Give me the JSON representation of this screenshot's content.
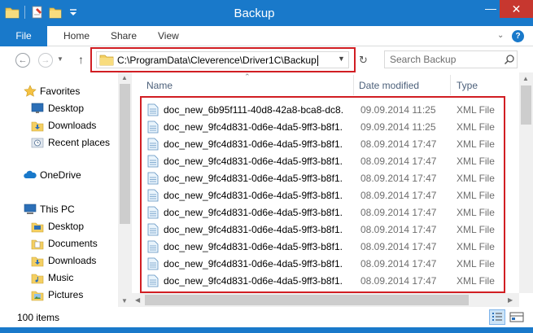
{
  "window": {
    "title": "Backup",
    "minimize_glyph": "—",
    "close_glyph": "✕"
  },
  "ribbon": {
    "file_tab": "File",
    "tabs": [
      "Home",
      "Share",
      "View"
    ],
    "expand_glyph": "⌄",
    "help_glyph": "?"
  },
  "address": {
    "path": "C:\\ProgramData\\Cleverence\\Driver1C\\Backup",
    "search_placeholder": "Search Backup"
  },
  "nav_pane": {
    "items": [
      {
        "label": "Favorites",
        "icon": "star-icon"
      },
      {
        "label": "Desktop",
        "icon": "desktop-icon"
      },
      {
        "label": "Downloads",
        "icon": "downloads-icon"
      },
      {
        "label": "Recent places",
        "icon": "recent-places-icon"
      },
      {
        "label": "OneDrive",
        "icon": "onedrive-icon"
      },
      {
        "label": "This PC",
        "icon": "computer-icon"
      },
      {
        "label": "Desktop",
        "icon": "desktop-icon"
      },
      {
        "label": "Documents",
        "icon": "documents-icon"
      },
      {
        "label": "Downloads",
        "icon": "downloads-icon"
      },
      {
        "label": "Music",
        "icon": "music-icon"
      },
      {
        "label": "Pictures",
        "icon": "pictures-icon"
      }
    ]
  },
  "file_list": {
    "columns": {
      "name": "Name",
      "date": "Date modified",
      "type": "Type"
    },
    "rows": [
      {
        "name": "doc_new_6b95f111-40d8-42a8-bca8-dc8...",
        "date": "09.09.2014 11:25",
        "type": "XML File"
      },
      {
        "name": "doc_new_9fc4d831-0d6e-4da5-9ff3-b8f1...",
        "date": "09.09.2014 11:25",
        "type": "XML File"
      },
      {
        "name": "doc_new_9fc4d831-0d6e-4da5-9ff3-b8f1...",
        "date": "08.09.2014 17:47",
        "type": "XML File"
      },
      {
        "name": "doc_new_9fc4d831-0d6e-4da5-9ff3-b8f1...",
        "date": "08.09.2014 17:47",
        "type": "XML File"
      },
      {
        "name": "doc_new_9fc4d831-0d6e-4da5-9ff3-b8f1...",
        "date": "08.09.2014 17:47",
        "type": "XML File"
      },
      {
        "name": "doc_new_9fc4d831-0d6e-4da5-9ff3-b8f1...",
        "date": "08.09.2014 17:47",
        "type": "XML File"
      },
      {
        "name": "doc_new_9fc4d831-0d6e-4da5-9ff3-b8f1...",
        "date": "08.09.2014 17:47",
        "type": "XML File"
      },
      {
        "name": "doc_new_9fc4d831-0d6e-4da5-9ff3-b8f1...",
        "date": "08.09.2014 17:47",
        "type": "XML File"
      },
      {
        "name": "doc_new_9fc4d831-0d6e-4da5-9ff3-b8f1...",
        "date": "08.09.2014 17:47",
        "type": "XML File"
      },
      {
        "name": "doc_new_9fc4d831-0d6e-4da5-9ff3-b8f1...",
        "date": "08.09.2014 17:47",
        "type": "XML File"
      },
      {
        "name": "doc_new_9fc4d831-0d6e-4da5-9ff3-b8f1...",
        "date": "08.09.2014 17:47",
        "type": "XML File"
      }
    ]
  },
  "status": {
    "item_count": "100 items"
  },
  "colors": {
    "accent": "#1979ca",
    "highlight_border": "#d11e23",
    "close_button": "#c7372f"
  }
}
